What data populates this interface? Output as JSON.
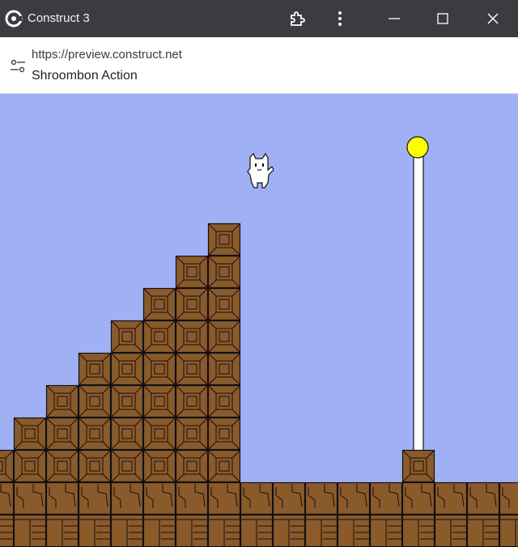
{
  "window": {
    "title": "Construct 3",
    "icons": [
      "construct-logo-icon",
      "extension-icon",
      "more-vert-icon",
      "minimize-icon",
      "maximize-icon",
      "close-icon"
    ]
  },
  "address_bar": {
    "url": "https://preview.construct.net",
    "page_title": "Shroombon Action",
    "icon": "site-settings-icon"
  },
  "game": {
    "sky_color": "#9fb0f5",
    "block_color": "#8b5a2b",
    "flag_ball_color": "#ffff00",
    "staircase_columns": 8,
    "player": "white-cat"
  }
}
